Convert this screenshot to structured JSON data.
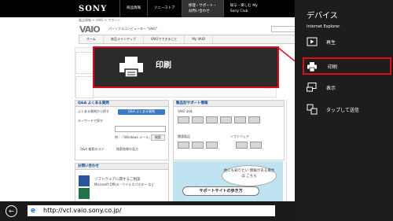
{
  "site": {
    "brand": "SONY",
    "nav": [
      "商品情報",
      "ソニーストア",
      "修理・サポート・お問い合わせ",
      "知る・楽しむ My Sony Club"
    ],
    "breadcrumb": "製品情報 > VAIO > サポート",
    "vaio_logo": "VAIO",
    "vaio_subtitle": "パーソナルコンピューター \"VAIO\"",
    "vaio_nav": [
      "ホーム",
      "商品ラインアップ",
      "VAIOでできること",
      "My VAIO"
    ],
    "qa_header": "Q&A よくある質問",
    "qa_text1": "よくある質問から探す",
    "qa_button": "Q&A よくある質問",
    "qa_text2": "キーワードで探す",
    "qa_hint": "例：「Windows メール」",
    "qa_search_btn": "検索",
    "qa_link1": "Q&A 検索のコツ",
    "qa_link2": "検索結果の見方",
    "product_header": "製品別サポート情報",
    "product_vaio": "VAIO 本体",
    "product_peripheral": "関連製品",
    "product_software": "ソフトウェア",
    "contact_header": "お問い合わせ",
    "contact_text1": "ソフトウェアに関するご相談",
    "contact_text2": "Microsoft Office・ウイルスバスター など",
    "bubble_text": "他にも知りたい 情報がある場合は こちら",
    "support_button": "サポートサイトの歩き方"
  },
  "overlay": {
    "label": "印刷"
  },
  "appbar": {
    "back_symbol": "←",
    "ie_symbol": "e",
    "url": "http://vcl.vaio.sony.co.jp/"
  },
  "charm": {
    "title": "デバイス",
    "subtitle": "Internet Explorer",
    "items": [
      {
        "label": "再生",
        "icon": "play-to-icon"
      },
      {
        "label": "印刷",
        "icon": "printer-icon",
        "selected": true
      },
      {
        "label": "表示",
        "icon": "display-icon"
      },
      {
        "label": "タップして送信",
        "icon": "tap-send-icon"
      }
    ]
  },
  "colors": {
    "highlight": "#e0081b",
    "charm_bg": "#1d1d1d",
    "overlay_bg": "#2b2b2b"
  }
}
